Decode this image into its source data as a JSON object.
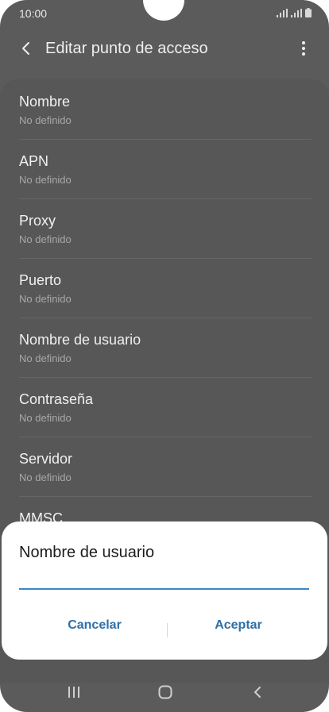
{
  "status_bar": {
    "time": "10:00"
  },
  "app_bar": {
    "title": "Editar punto de acceso"
  },
  "fields": [
    {
      "title": "Nombre",
      "value": "No definido"
    },
    {
      "title": "APN",
      "value": "No definido"
    },
    {
      "title": "Proxy",
      "value": "No definido"
    },
    {
      "title": "Puerto",
      "value": "No definido"
    },
    {
      "title": "Nombre de usuario",
      "value": "No definido"
    },
    {
      "title": "Contraseña",
      "value": "No definido"
    },
    {
      "title": "Servidor",
      "value": "No definido"
    },
    {
      "title": "MMSC",
      "value": ""
    }
  ],
  "dialog": {
    "title": "Nombre de usuario",
    "input_value": "",
    "cancel_label": "Cancelar",
    "accept_label": "Aceptar"
  },
  "colors": {
    "accent": "#2e6fa8",
    "input_underline": "#3a86c8",
    "scrim": "#5b5b5b"
  }
}
